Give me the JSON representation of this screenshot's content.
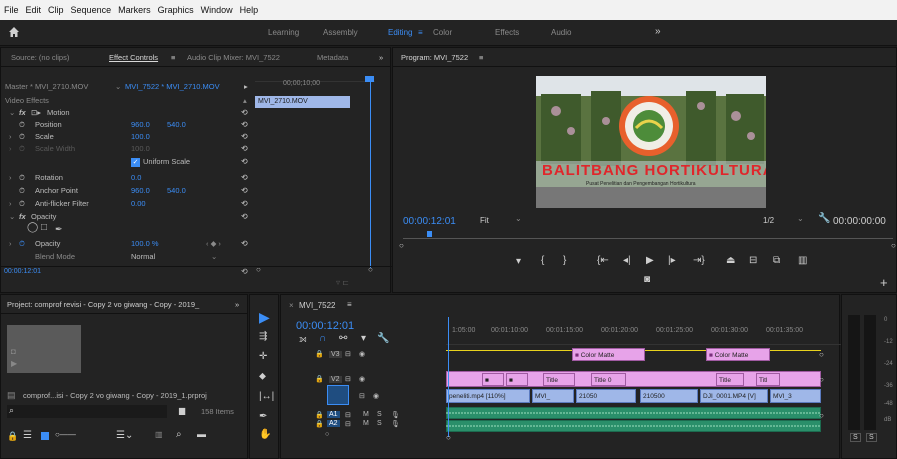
{
  "menu": [
    "File",
    "Edit",
    "Clip",
    "Sequence",
    "Markers",
    "Graphics",
    "Window",
    "Help"
  ],
  "workspaces": {
    "learning": "Learning",
    "assembly": "Assembly",
    "editing": "Editing",
    "color": "Color",
    "effects": "Effects",
    "audio": "Audio",
    "more": "»"
  },
  "source_panel": {
    "tabs": {
      "source": "Source: (no clips)",
      "effect_controls": "Effect Controls",
      "mixer": "Audio Clip Mixer: MVI_7522",
      "metadata": "Metadata"
    },
    "master": "Master * MVI_2710.MOV",
    "clip_ref": "MVI_7522 * MVI_2710.MOV",
    "ruler_tc": "00;00;10;00",
    "clip_name": "MVI_2710.MOV",
    "video_effects": "Video Effects",
    "motion": "Motion",
    "position": {
      "label": "Position",
      "x": "960.0",
      "y": "540.0"
    },
    "scale": {
      "label": "Scale",
      "value": "100.0"
    },
    "scale_width": {
      "label": "Scale Width",
      "value": "100.0"
    },
    "uniform_scale": "Uniform Scale",
    "rotation": {
      "label": "Rotation",
      "value": "0.0"
    },
    "anchor": {
      "label": "Anchor Point",
      "x": "960.0",
      "y": "540.0"
    },
    "antiflicker": {
      "label": "Anti-flicker Filter",
      "value": "0.00"
    },
    "opacity_group": "Opacity",
    "opacity": {
      "label": "Opacity",
      "value": "100.0 %"
    },
    "blend": {
      "label": "Blend Mode",
      "value": "Normal"
    },
    "timecode": "00:00:12:01"
  },
  "program": {
    "title": "Program: MVI_7522",
    "timecode": "00:00:12:01",
    "fit": "Fit",
    "res": "1/2",
    "duration": "00:00:00:00",
    "sign_text": "BALITBANG HORTIKULTURA",
    "sign_sub": "Pusat Penelitian dan Pengembangan Hortikultura"
  },
  "project": {
    "title": "Project: comprof revisi - Copy 2 vo giwang - Copy - 2019_",
    "file": "comprof...isi - Copy 2 vo giwang - Copy - 2019_1.prproj",
    "items": "158 Items"
  },
  "timeline": {
    "seq": "MVI_7522",
    "timecode": "00:00:12:01",
    "ruler": [
      "1:05:00",
      "00:01:10:00",
      "00:01:15:00",
      "00:01:20:00",
      "00:01:25:00",
      "00:01:30:00",
      "00:01:35:00"
    ],
    "tracks": {
      "v3": "V3",
      "v2": "V2",
      "v1": "V1",
      "a1": "A1",
      "a2": "A2",
      "m": "M",
      "s": "S"
    },
    "clips": {
      "color_matte_1": "Color Matte",
      "color_matte_2": "Color Matte",
      "title_1": "Title",
      "title_2": "Title 0",
      "title_3": "Title",
      "title_4": "Titl",
      "penelitian": "peneliti.mp4 [110%]",
      "mvi_1": "MVI_",
      "n21050": "21050",
      "n21050b": "210500",
      "dji": "DJI_0001.MP4 [V]",
      "mvi_2": "MVI_3"
    }
  },
  "meter": {
    "ticks": [
      "0",
      "-12",
      "-24",
      "-36",
      "-48",
      "dB"
    ],
    "solo": "S"
  }
}
